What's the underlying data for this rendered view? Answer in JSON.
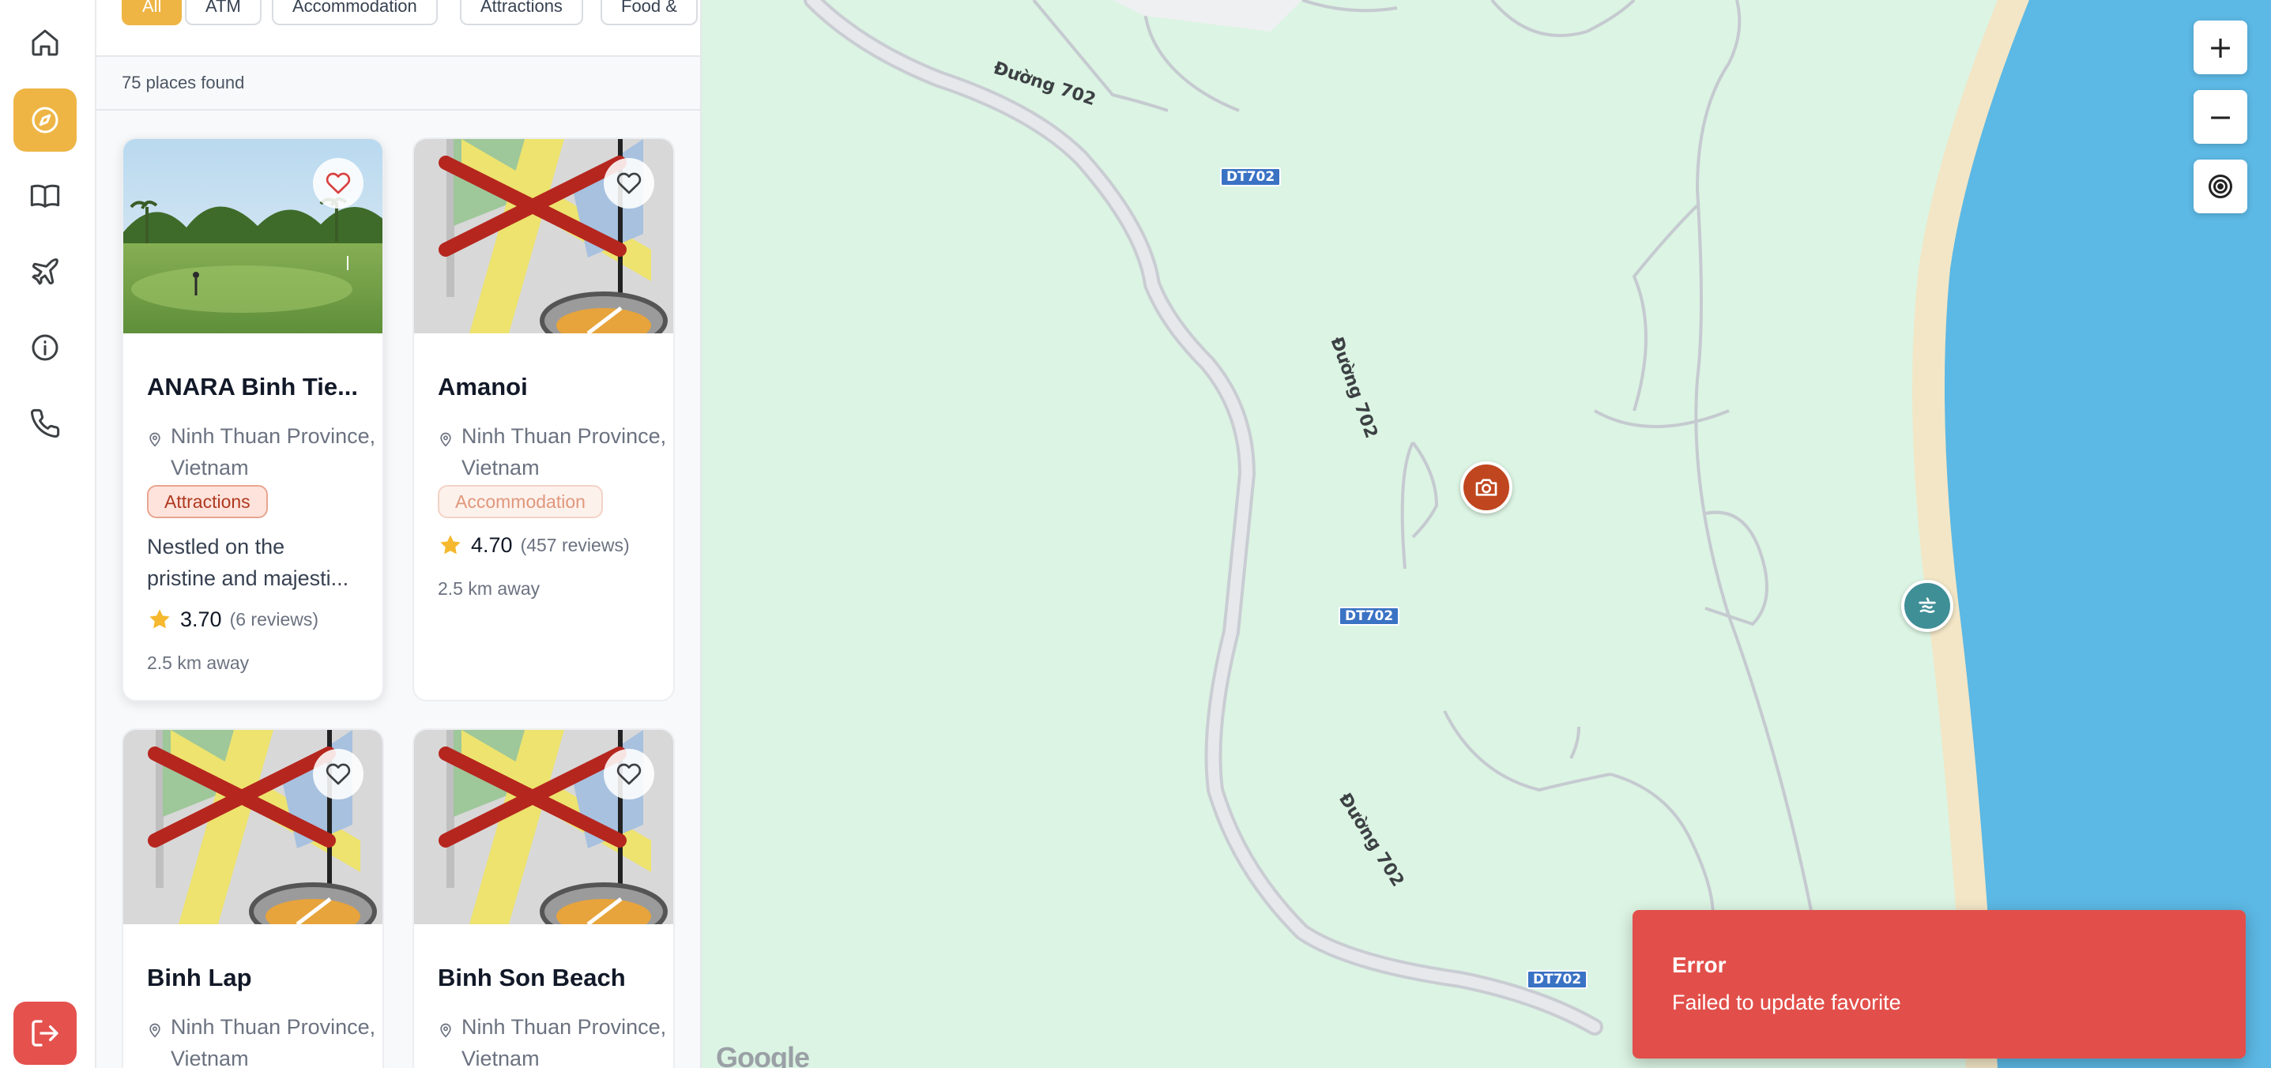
{
  "nav": {
    "items": [
      {
        "icon": "home-icon"
      },
      {
        "icon": "compass-icon",
        "active": true
      },
      {
        "icon": "book-icon"
      },
      {
        "icon": "plane-icon"
      },
      {
        "icon": "info-icon"
      },
      {
        "icon": "phone-icon"
      }
    ],
    "logout_icon": "logout-icon"
  },
  "filters": {
    "chips": [
      "All",
      "ATM",
      "Accommodation",
      "Attractions",
      "Food &"
    ],
    "active": "All"
  },
  "results": {
    "count_text": "75 places found"
  },
  "places": [
    {
      "title": "ANARA Binh Tie...",
      "location": "Ninh Thuan Province, Vietnam",
      "category": "Attractions",
      "description_line1": "Nestled on the",
      "description_line2": "pristine and majesti...",
      "rating": "3.70",
      "reviews": "(6 reviews)",
      "distance": "2.5 km away",
      "favorited": true
    },
    {
      "title": "Amanoi",
      "location": "Ninh Thuan Province, Vietnam",
      "category": "Accommodation",
      "rating": "4.70",
      "reviews": "(457 reviews)",
      "distance": "2.5 km away",
      "favorited": false
    },
    {
      "title": "Binh Lap",
      "location": "Ninh Thuan Province, Vietnam",
      "favorited": false
    },
    {
      "title": "Binh Son Beach",
      "location": "Ninh Thuan Province, Vietnam",
      "favorited": false
    }
  ],
  "map": {
    "road_name": "Đường 702",
    "road_shield": "DT702",
    "zoom_in": "+",
    "zoom_out": "−",
    "attribution": "Google",
    "markers": [
      {
        "type": "attraction",
        "icon": "camera-icon",
        "color": "#c0461f"
      },
      {
        "type": "beach",
        "icon": "beach-icon",
        "color": "#3f8f97"
      }
    ],
    "colors": {
      "land": "#dcf4e3",
      "water": "#5cb8e4",
      "sand": "#f2e6c6",
      "road": "#d4d8de"
    }
  },
  "toast": {
    "title": "Error",
    "message": "Failed to update favorite",
    "color": "#e24f4a"
  }
}
